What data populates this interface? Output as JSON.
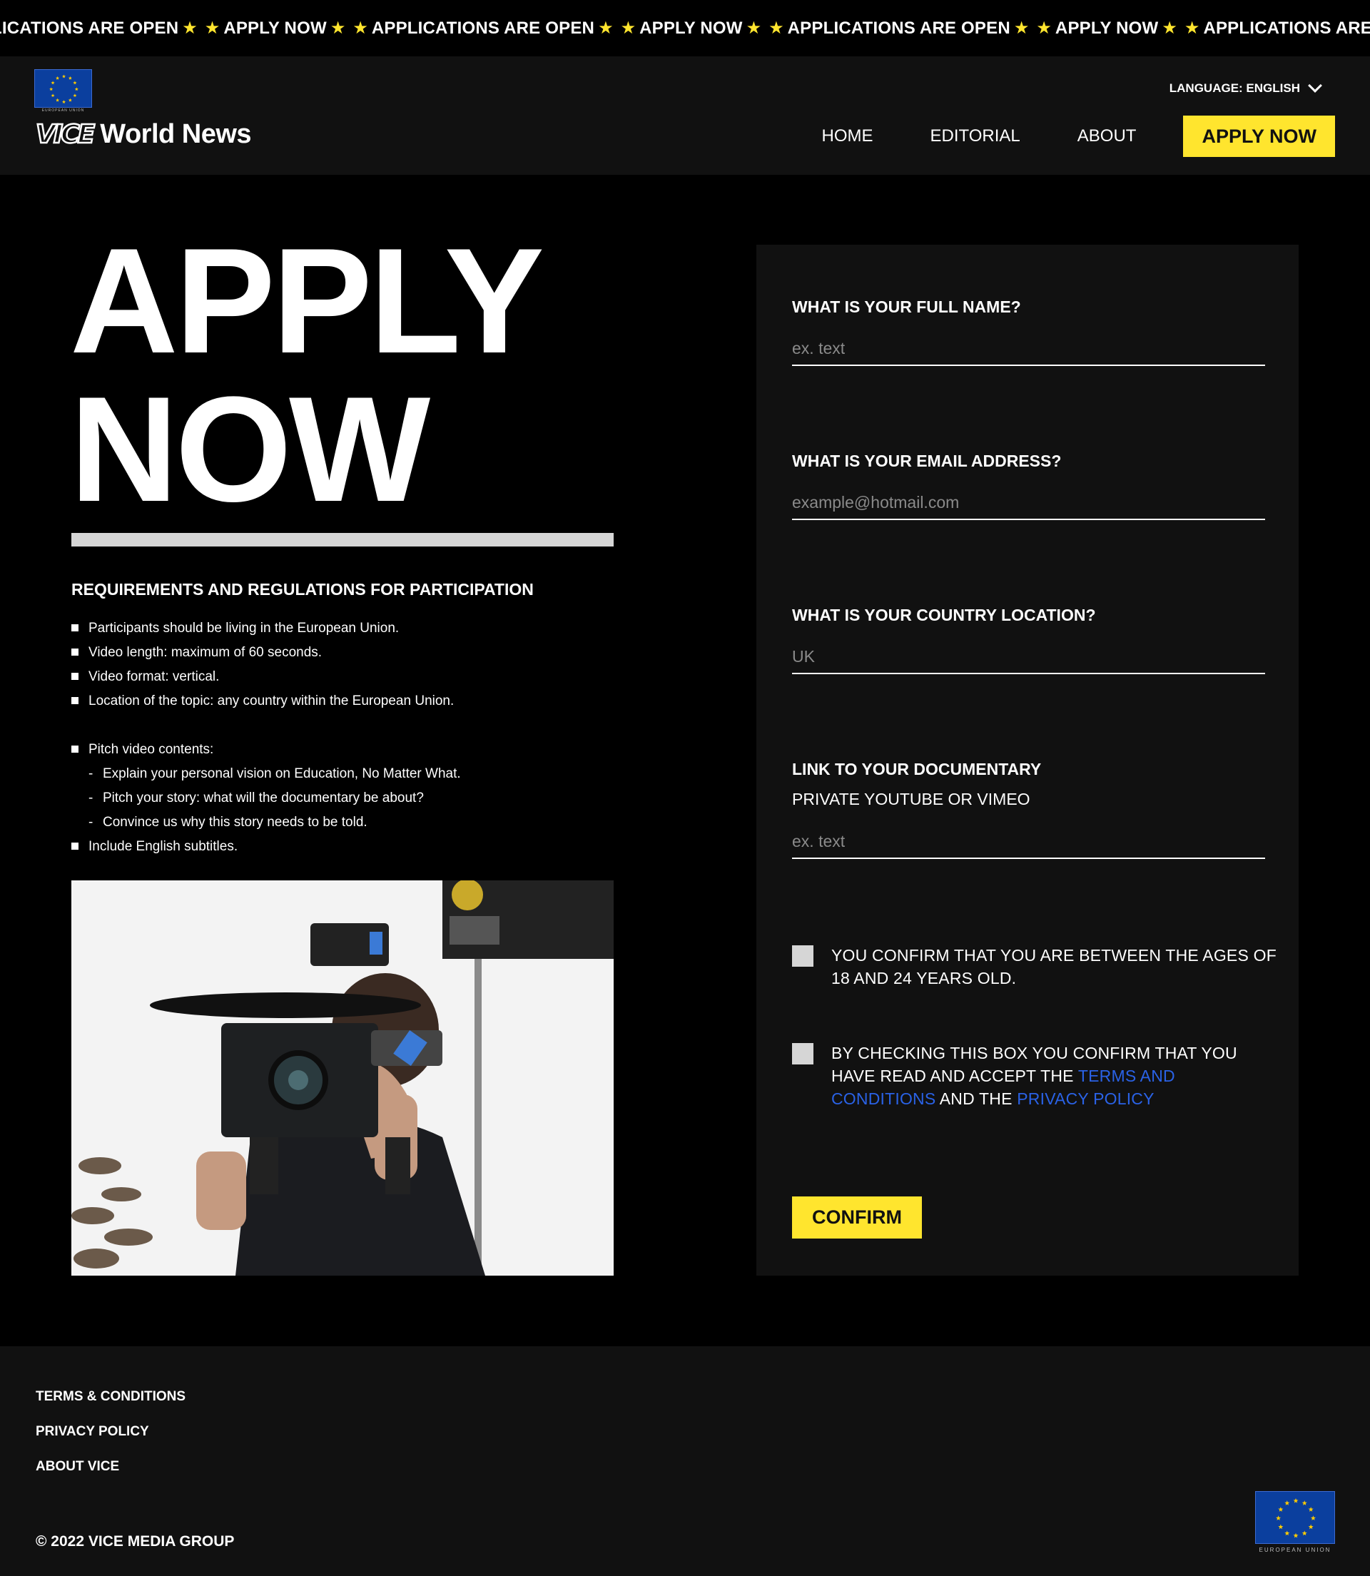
{
  "ticker": {
    "items": [
      "LICATIONS ARE OPEN",
      "APPLY NOW",
      "APPLICATIONS ARE OPEN",
      "APPLY NOW",
      "APPLICATIONS ARE OPEN",
      "APPLY NOW",
      "APPLICATIONS ARE OPEN"
    ],
    "star": "★"
  },
  "header": {
    "eu_caption": "EUROPEAN UNION",
    "logo_mark": "VICE",
    "logo_text": "World News",
    "language_label": "LANGUAGE: ENGLISH",
    "nav": [
      {
        "label": "HOME"
      },
      {
        "label": "EDITORIAL"
      },
      {
        "label": "ABOUT"
      }
    ],
    "cta_label": "APPLY NOW"
  },
  "hero": {
    "line1": "APPLY",
    "line2": "NOW"
  },
  "requirements": {
    "title": "REQUIREMENTS AND REGULATIONS FOR PARTICIPATION",
    "items": [
      "Participants should be living in the European Union.",
      "Video length: maximum of 60 seconds.",
      "Video format: vertical.",
      "Location of the topic: any country within the European Union."
    ],
    "pitch_label": "Pitch video contents:",
    "pitch_items": [
      "Explain your personal vision on Education, No Matter What.",
      "Pitch your story: what will the documentary be about?",
      "Convince us why this story needs to be told."
    ],
    "final_item": "Include English subtitles."
  },
  "form": {
    "name_label": "WHAT IS YOUR FULL NAME?",
    "name_placeholder": "ex. text",
    "email_label": "WHAT IS YOUR EMAIL ADDRESS?",
    "email_placeholder": "example@hotmail.com",
    "country_label": "WHAT IS YOUR COUNTRY LOCATION?",
    "country_value": "UK",
    "doc_label": "LINK TO YOUR DOCUMENTARY",
    "doc_sublabel": "PRIVATE YOUTUBE OR VIMEO",
    "doc_placeholder": "ex. text",
    "age_confirm": "YOU CONFIRM THAT YOU ARE BETWEEN THE AGES OF 18 AND 24 YEARS OLD.",
    "terms_prefix": "BY CHECKING THIS BOX YOU CONFIRM THAT YOU HAVE READ AND ACCEPT THE",
    "terms_link": "TERMS AND CONDITIONS",
    "terms_and": "AND THE",
    "privacy_link": "PRIVACY POLICY",
    "confirm_label": "CONFIRM"
  },
  "footer": {
    "links": [
      "TERMS & CONDITIONS",
      "PRIVACY POLICY",
      "ABOUT VICE"
    ],
    "copyright": "© 2022 VICE MEDIA GROUP",
    "eu_caption": "EUROPEAN UNION"
  },
  "colors": {
    "accent": "#ffe52e",
    "link": "#2a62e6",
    "background": "#000000",
    "panel": "#111111",
    "eu_blue": "#0b3f9e",
    "eu_star": "#ffcc00"
  }
}
